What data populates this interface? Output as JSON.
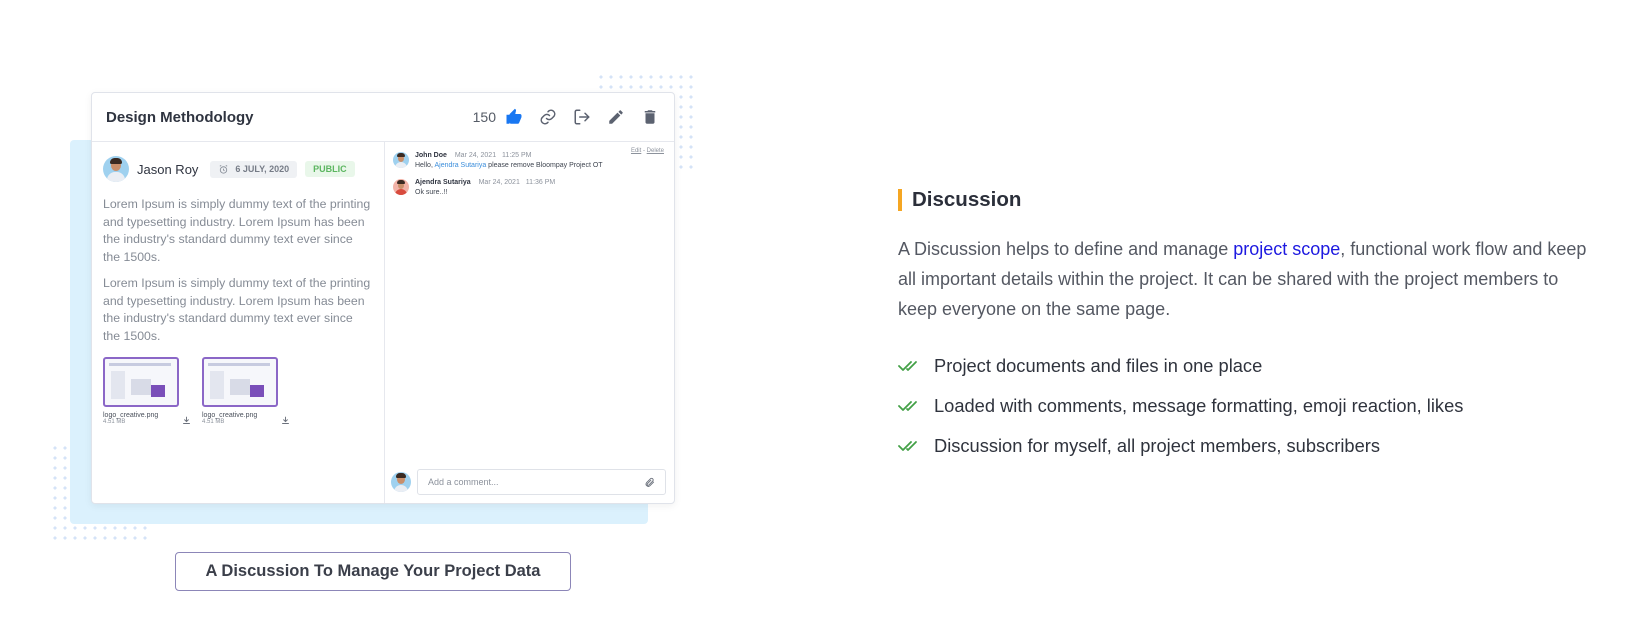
{
  "card": {
    "title": "Design Methodology",
    "like_count": "150",
    "header_icons": [
      "thumbs-up-icon",
      "link-icon",
      "share-exit-icon",
      "pencil-icon",
      "trash-icon"
    ],
    "post": {
      "author": "Jason Roy",
      "date": "6 JULY, 2020",
      "visibility": "PUBLIC",
      "paragraphs": [
        "Lorem Ipsum is simply dummy text of the printing and typesetting industry. Lorem Ipsum has been the industry's standard dummy text ever since the 1500s.",
        "Lorem Ipsum is simply dummy text of the printing and typesetting industry. Lorem Ipsum has been the industry's standard dummy text ever since the 1500s."
      ],
      "attachments": [
        {
          "name": "logo_creative.png",
          "size": "4.51 MB"
        },
        {
          "name": "logo_creative.png",
          "size": "4.51 MB"
        }
      ]
    },
    "comments": {
      "edit_label": "Edit",
      "separator": "-",
      "delete_label": "Delete",
      "items": [
        {
          "author": "John Doe",
          "date": "Mar 24, 2021",
          "time": "11:25 PM",
          "text_before": "Hello, ",
          "mention": "Ajendra Sutariya",
          "text_after": " please remove Bloompay Project OT"
        },
        {
          "author": "Ajendra Sutariya",
          "date": "Mar 24, 2021",
          "time": "11:36 PM",
          "text_before": "Ok sure..!!",
          "mention": "",
          "text_after": ""
        }
      ],
      "input_placeholder": "Add a comment..."
    }
  },
  "caption": "A Discussion To Manage Your Project Data",
  "section": {
    "title": "Discussion",
    "accent_color": "#f5a623",
    "desc_before": "A Discussion helps to define and manage ",
    "desc_link": "project scope",
    "desc_after": ", functional work flow and keep all important details within the project. It can be shared with the project members to keep everyone on the same page.",
    "features": [
      "Project documents and files in one place",
      "Loaded with comments, message formatting, emoji reaction, likes",
      "Discussion for myself, all project members, subscribers"
    ],
    "check_color": "#43a047"
  }
}
